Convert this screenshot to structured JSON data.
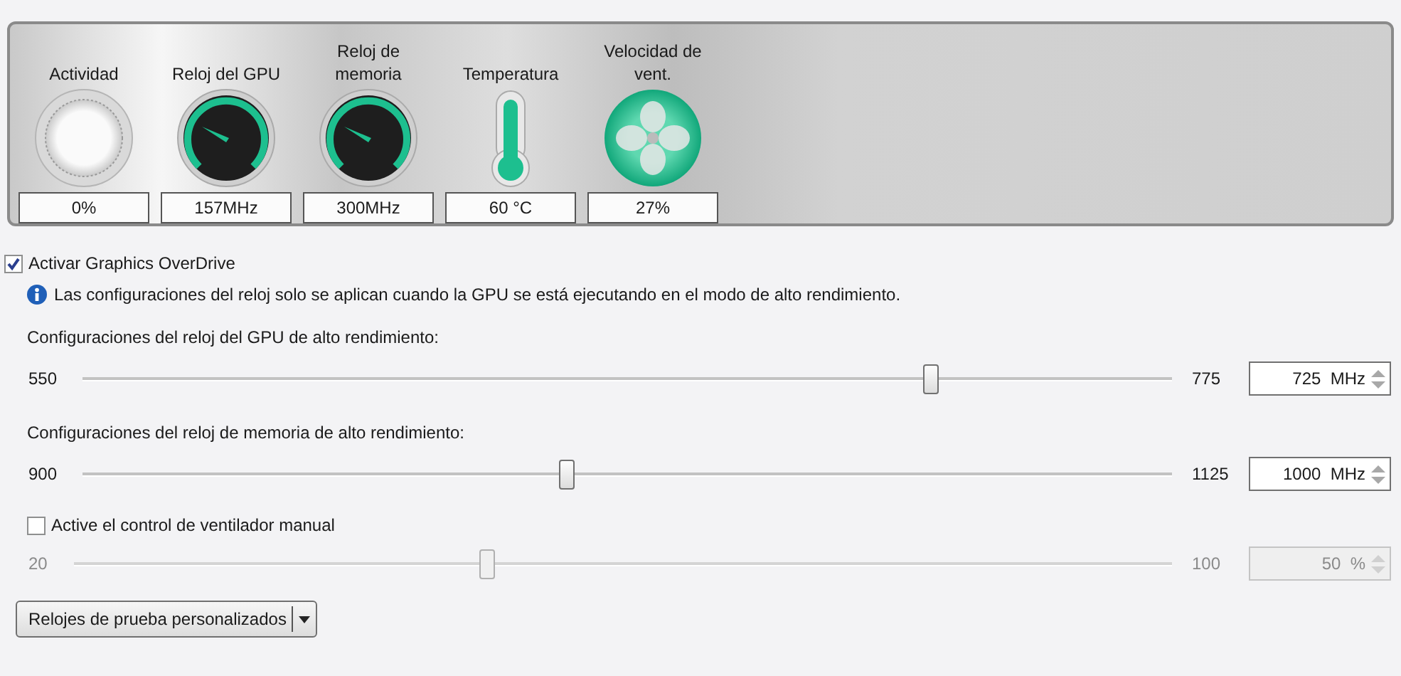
{
  "monitors": [
    {
      "kind": "ring",
      "label": "Actividad",
      "value": "0%"
    },
    {
      "kind": "dial",
      "label": "Reloj del GPU",
      "value": "157MHz"
    },
    {
      "kind": "dial",
      "label": "Reloj de memoria",
      "value": "300MHz"
    },
    {
      "kind": "thermometer",
      "label": "Temperatura",
      "value": "60 °C"
    },
    {
      "kind": "fan",
      "label": "Velocidad de vent.",
      "value": "27%"
    }
  ],
  "overdrive": {
    "label": "Activar Graphics OverDrive",
    "checked": true
  },
  "info": "Las configuraciones del reloj solo se aplican cuando la GPU se está ejecutando en el modo de alto rendimiento.",
  "sliders": [
    {
      "kind": "plain",
      "label": "Configuraciones del reloj del GPU de alto rendimiento:",
      "min": "550",
      "max": "775",
      "level": 0.778,
      "value": "725",
      "unit": "MHz",
      "disabled": false
    },
    {
      "kind": "plain",
      "label": "Configuraciones del reloj de memoria de alto rendimiento:",
      "min": "900",
      "max": "1125",
      "level": 0.444,
      "value": "1000",
      "unit": "MHz",
      "disabled": false
    },
    {
      "kind": "checkbox",
      "label": "Active el control de ventilador manual",
      "checked": false,
      "min": "20",
      "max": "100",
      "level": 0.375,
      "value": "50",
      "unit": "%",
      "disabled": true
    }
  ],
  "test_button": "Relojes de prueba personalizados"
}
